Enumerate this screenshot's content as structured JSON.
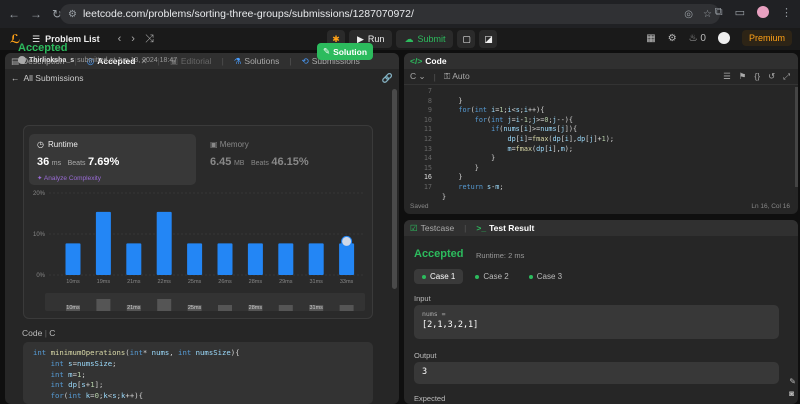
{
  "browser": {
    "url": "leetcode.com/problems/sorting-three-groups/submissions/1287070972/"
  },
  "header": {
    "problem_list": "Problem List",
    "run": "Run",
    "submit": "Submit",
    "streak": "0",
    "premium": "Premium"
  },
  "left_tabs": [
    {
      "label": "Description"
    },
    {
      "label": "Accepted"
    },
    {
      "label": "Editorial"
    },
    {
      "label": "Solutions"
    },
    {
      "label": "Submissions"
    }
  ],
  "submission": {
    "back_label": "All Submissions",
    "status": "Accepted",
    "user": "Thirlioksha_s",
    "submitted_text": "submitted at Jun 13, 2024 18:47",
    "solution_btn": "Solution",
    "runtime_label": "Runtime",
    "runtime_value": "36",
    "runtime_unit": "ms",
    "runtime_beats_label": "Beats",
    "runtime_beats": "7.69%",
    "analyze": "Analyze Complexity",
    "memory_label": "Memory",
    "memory_value": "6.45",
    "memory_unit": "MB",
    "memory_beats_label": "Beats",
    "memory_beats": "46.15%",
    "code_label": "Code",
    "code_lang": "C"
  },
  "chart_data": {
    "type": "bar",
    "categories": [
      "10ms",
      "19ms",
      "21ms",
      "22ms",
      "25ms",
      "26ms",
      "28ms",
      "29ms",
      "31ms",
      "33ms"
    ],
    "values": [
      7.7,
      15.4,
      7.7,
      15.4,
      7.7,
      7.7,
      7.7,
      7.7,
      7.7,
      7.7
    ],
    "yticks": [
      "20%",
      "10%",
      "0%"
    ],
    "ylim": [
      0,
      20
    ],
    "mini_labels": [
      "10ms",
      "21ms",
      "25ms",
      "28ms",
      "31ms"
    ],
    "mini_values": [
      1,
      2,
      1,
      2,
      1,
      1,
      1,
      1,
      1,
      1
    ],
    "bar_color": "#2386f5"
  },
  "code_preview": [
    "int minimumOperations(int* nums, int numsSize){",
    "    int s=numsSize;",
    "    int m=1;",
    "    int dp[s+1];",
    "    for(int k=0;k<s;k++){"
  ],
  "editor": {
    "title": "Code",
    "lang": "C",
    "mode": "Auto",
    "line_numbers": [
      "7",
      "8",
      "9",
      "10",
      "11",
      "12",
      "13",
      "14",
      "15",
      "16",
      "17"
    ],
    "current_line": "16",
    "lines": [
      "    }",
      "    for(int i=1;i<s;i++){",
      "        for(int j=i-1;j>=0;j--){",
      "            if(nums[i]>=nums[j]){",
      "                dp[i]=fmax(dp[i],dp[j]+1);",
      "                m=fmax(dp[i],m);",
      "            }",
      "        }",
      "    }",
      "    return s-m;",
      "}"
    ],
    "saved": "Saved",
    "position": "Ln 16, Col 16"
  },
  "test": {
    "tab_testcase": "Testcase",
    "tab_result": "Test Result",
    "status": "Accepted",
    "runtime": "Runtime: 2 ms",
    "cases": [
      "Case 1",
      "Case 2",
      "Case 3"
    ],
    "input_label": "Input",
    "input_var": "nums =",
    "input_value": "[2,1,3,2,1]",
    "output_label": "Output",
    "output_value": "3",
    "expected_label": "Expected"
  }
}
